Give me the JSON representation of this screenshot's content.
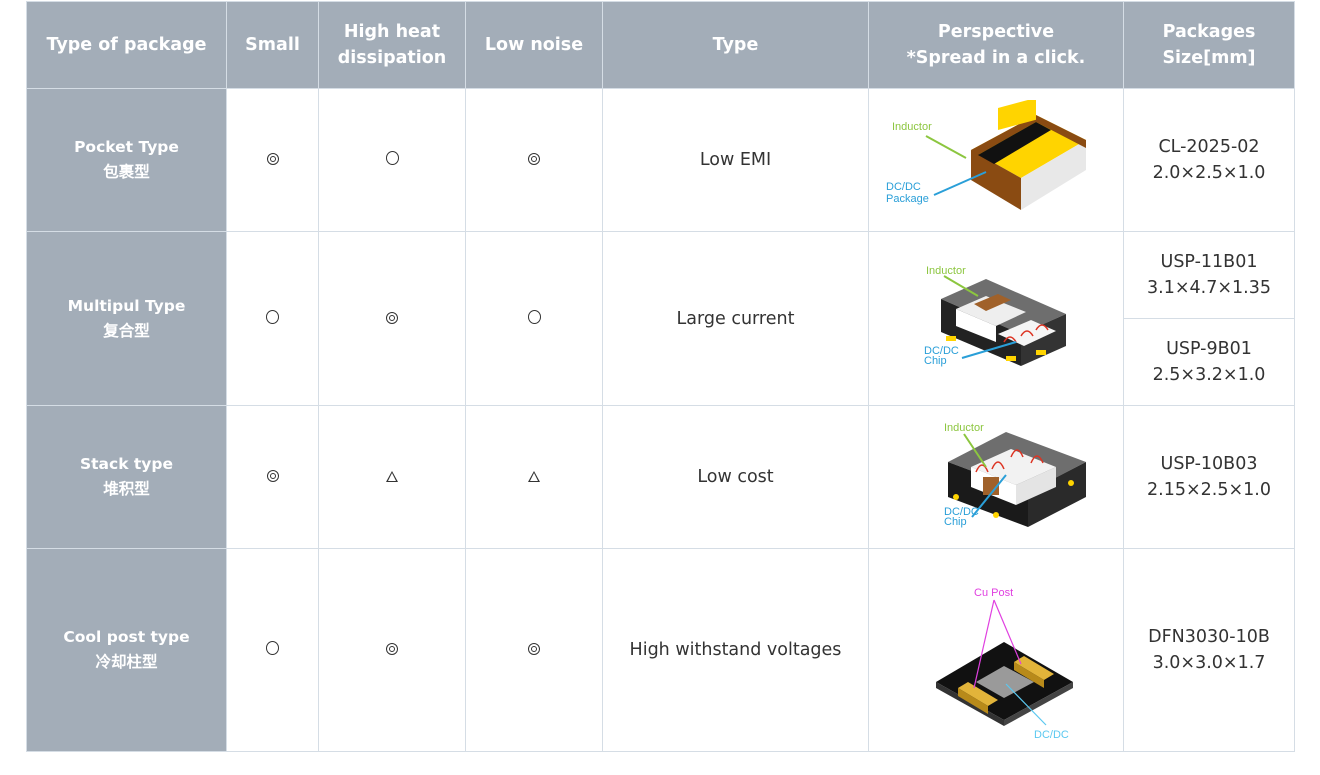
{
  "table": {
    "headers": [
      {
        "line1": "Type of package",
        "line2": ""
      },
      {
        "line1": "Small",
        "line2": ""
      },
      {
        "line1": "High heat",
        "line2": "dissipation"
      },
      {
        "line1": "Low noise",
        "line2": ""
      },
      {
        "line1": "Type",
        "line2": ""
      },
      {
        "line1": "Perspective",
        "line2": "*Spread in a click."
      },
      {
        "line1": "Packages",
        "line2": "Size[mm]"
      }
    ],
    "rows": [
      {
        "name_en": "Pocket Type",
        "name_cn": "包裹型",
        "small": "double-circle",
        "heat": "circle",
        "noise": "double-circle",
        "type": "Low EMI",
        "image": {
          "icon": "pocket-package-illustration",
          "labels": [
            "Inductor",
            "DC/DC",
            "Package"
          ]
        },
        "packages": [
          {
            "name": "CL-2025-02",
            "size": "2.0×2.5×1.0"
          }
        ]
      },
      {
        "name_en": "Multipul Type",
        "name_cn": "复合型",
        "small": "circle",
        "heat": "double-circle",
        "noise": "circle",
        "type": "Large current",
        "image": {
          "icon": "multiple-package-illustration",
          "labels": [
            "Inductor",
            "DC/DC",
            "Chip"
          ]
        },
        "packages": [
          {
            "name": "USP-11B01",
            "size": "3.1×4.7×1.35"
          },
          {
            "name": "USP-9B01",
            "size": "2.5×3.2×1.0"
          }
        ]
      },
      {
        "name_en": "Stack type",
        "name_cn": "堆积型",
        "small": "double-circle",
        "heat": "triangle",
        "noise": "triangle",
        "type": "Low cost",
        "image": {
          "icon": "stack-package-illustration",
          "labels": [
            "Inductor",
            "DC/DC",
            "Chip"
          ]
        },
        "packages": [
          {
            "name": "USP-10B03",
            "size": "2.15×2.5×1.0"
          }
        ]
      },
      {
        "name_en": "Cool post type",
        "name_cn": "冷却柱型",
        "small": "circle",
        "heat": "double-circle",
        "noise": "double-circle",
        "type": "High withstand voltages",
        "image": {
          "icon": "cool-post-package-illustration",
          "labels": [
            "Cu Post",
            "DC/DC"
          ]
        },
        "packages": [
          {
            "name": "DFN3030-10B",
            "size": "3.0×3.0×1.7"
          }
        ]
      }
    ]
  },
  "colors": {
    "header_bg": "#a3adb8",
    "border": "#d5dde5",
    "inductor_label": "#8cc63f",
    "dcdc_label": "#2a9fd8",
    "cu_post_label": "#e040e0"
  }
}
